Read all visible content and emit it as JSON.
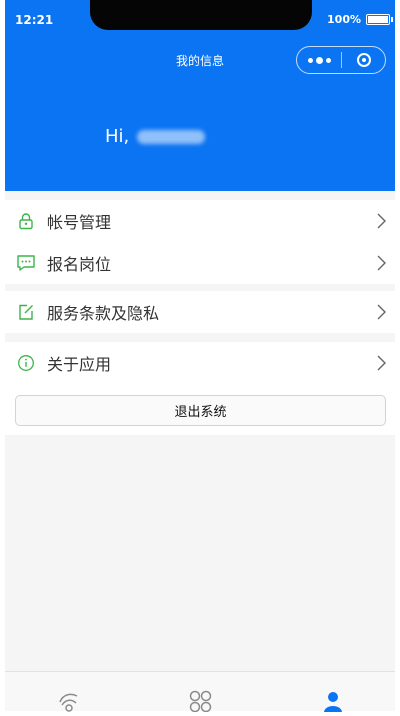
{
  "status_bar": {
    "time": "12:21",
    "battery": "100%"
  },
  "header": {
    "title": "我的信息",
    "greeting": "Hi,",
    "color": "#0b74f2"
  },
  "capsule": {
    "more_icon": "more-dots-icon",
    "close_icon": "target-circle-icon"
  },
  "menu": {
    "account": {
      "label": "帐号管理",
      "icon": "lock-icon"
    },
    "apply": {
      "label": "报名岗位",
      "icon": "chat-bubble-icon"
    },
    "terms": {
      "label": "服务条款及隐私",
      "icon": "edit-icon"
    },
    "about": {
      "label": "关于应用",
      "icon": "info-icon"
    }
  },
  "logout": {
    "label": "退出系统"
  },
  "tabbar": {
    "items": [
      {
        "icon": "home-icon",
        "selected": false
      },
      {
        "icon": "grid-icon",
        "selected": false
      },
      {
        "icon": "user-icon",
        "selected": true
      }
    ]
  },
  "colors": {
    "accent": "#0b74f2",
    "icon_green": "#3bb54a",
    "page_bg": "#f5f5f5"
  }
}
